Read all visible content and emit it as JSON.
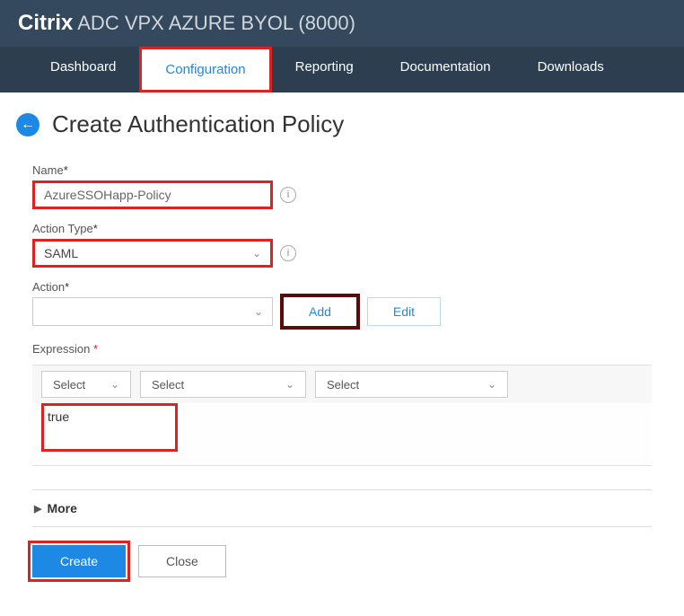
{
  "header": {
    "brand": "Citrix",
    "product": " ADC VPX AZURE BYOL (8000)"
  },
  "nav": {
    "items": [
      "Dashboard",
      "Configuration",
      "Reporting",
      "Documentation",
      "Downloads"
    ],
    "active_index": 1
  },
  "page": {
    "title": "Create Authentication Policy"
  },
  "form": {
    "name": {
      "label": "Name",
      "required_mark": "*",
      "value": "AzureSSOHapp-Policy"
    },
    "action_type": {
      "label": "Action Type",
      "required_mark": "*",
      "value": "SAML"
    },
    "action": {
      "label": "Action",
      "required_mark": "*",
      "value": "",
      "add_label": "Add",
      "edit_label": "Edit"
    },
    "expression": {
      "label": "Expression",
      "required_mark": "*",
      "select_placeholder": "Select",
      "value": "true"
    }
  },
  "more": {
    "label": "More"
  },
  "footer": {
    "create_label": "Create",
    "close_label": "Close"
  }
}
